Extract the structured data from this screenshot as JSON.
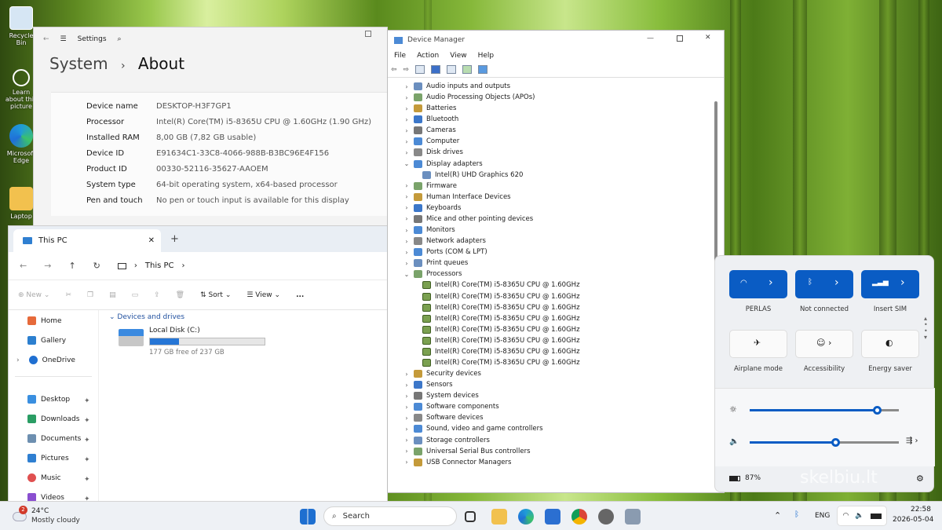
{
  "desktop": {
    "icons": [
      {
        "label": "Recycle Bin",
        "icon": "recycle-bin-icon"
      },
      {
        "label": "Learn about this picture",
        "icon": "learn-icon"
      },
      {
        "label": "Microsoft Edge",
        "icon": "edge-icon"
      },
      {
        "label": "Laptop",
        "icon": "folder-user-icon"
      }
    ]
  },
  "settings": {
    "app_title": "Settings",
    "crumb_parent": "System",
    "crumb_sep": "›",
    "crumb_current": "About",
    "specs": [
      {
        "label": "Device name",
        "value": "DESKTOP-H3F7GP1"
      },
      {
        "label": "Processor",
        "value": "Intel(R) Core(TM) i5-8365U CPU @ 1.60GHz (1.90 GHz)"
      },
      {
        "label": "Installed RAM",
        "value": "8,00 GB (7,82 GB usable)"
      },
      {
        "label": "Device ID",
        "value": "E91634C1-33C8-4066-988B-B3BC96E4F156"
      },
      {
        "label": "Product ID",
        "value": "00330-52116-35627-AAOEM"
      },
      {
        "label": "System type",
        "value": "64-bit operating system, x64-based processor"
      },
      {
        "label": "Pen and touch",
        "value": "No pen or touch input is available for this display"
      }
    ]
  },
  "explorer": {
    "tab_title": "This PC",
    "address": "This PC",
    "toolbar": {
      "new": "New",
      "sort": "Sort",
      "view": "View",
      "more": "..."
    },
    "nav": [
      "Home",
      "Gallery",
      "OneDrive",
      "Desktop",
      "Downloads",
      "Documents",
      "Pictures",
      "Music",
      "Videos"
    ],
    "section": "Devices and drives",
    "drive": {
      "name": "Local Disk (C:)",
      "free": "177 GB free of 237 GB",
      "used_fraction": 0.253
    }
  },
  "devmgr": {
    "title": "Device Manager",
    "menu": [
      "File",
      "Action",
      "View",
      "Help"
    ],
    "tree": [
      {
        "label": "Audio inputs and outputs",
        "level": 1,
        "expanded": false
      },
      {
        "label": "Audio Processing Objects (APOs)",
        "level": 1,
        "expanded": false
      },
      {
        "label": "Batteries",
        "level": 1,
        "expanded": false
      },
      {
        "label": "Bluetooth",
        "level": 1,
        "expanded": false
      },
      {
        "label": "Cameras",
        "level": 1,
        "expanded": false
      },
      {
        "label": "Computer",
        "level": 1,
        "expanded": false
      },
      {
        "label": "Disk drives",
        "level": 1,
        "expanded": false
      },
      {
        "label": "Display adapters",
        "level": 1,
        "expanded": true
      },
      {
        "label": "Intel(R) UHD Graphics 620",
        "level": 2
      },
      {
        "label": "Firmware",
        "level": 1,
        "expanded": false
      },
      {
        "label": "Human Interface Devices",
        "level": 1,
        "expanded": false
      },
      {
        "label": "Keyboards",
        "level": 1,
        "expanded": false
      },
      {
        "label": "Mice and other pointing devices",
        "level": 1,
        "expanded": false
      },
      {
        "label": "Monitors",
        "level": 1,
        "expanded": false
      },
      {
        "label": "Network adapters",
        "level": 1,
        "expanded": false
      },
      {
        "label": "Ports (COM & LPT)",
        "level": 1,
        "expanded": false
      },
      {
        "label": "Print queues",
        "level": 1,
        "expanded": false
      },
      {
        "label": "Processors",
        "level": 1,
        "expanded": true
      },
      {
        "label": "Intel(R) Core(TM) i5-8365U CPU @ 1.60GHz",
        "level": 2
      },
      {
        "label": "Intel(R) Core(TM) i5-8365U CPU @ 1.60GHz",
        "level": 2
      },
      {
        "label": "Intel(R) Core(TM) i5-8365U CPU @ 1.60GHz",
        "level": 2
      },
      {
        "label": "Intel(R) Core(TM) i5-8365U CPU @ 1.60GHz",
        "level": 2
      },
      {
        "label": "Intel(R) Core(TM) i5-8365U CPU @ 1.60GHz",
        "level": 2
      },
      {
        "label": "Intel(R) Core(TM) i5-8365U CPU @ 1.60GHz",
        "level": 2
      },
      {
        "label": "Intel(R) Core(TM) i5-8365U CPU @ 1.60GHz",
        "level": 2
      },
      {
        "label": "Intel(R) Core(TM) i5-8365U CPU @ 1.60GHz",
        "level": 2
      },
      {
        "label": "Security devices",
        "level": 1,
        "expanded": false
      },
      {
        "label": "Sensors",
        "level": 1,
        "expanded": false
      },
      {
        "label": "System devices",
        "level": 1,
        "expanded": false
      },
      {
        "label": "Software components",
        "level": 1,
        "expanded": false
      },
      {
        "label": "Software devices",
        "level": 1,
        "expanded": false
      },
      {
        "label": "Sound, video and game controllers",
        "level": 1,
        "expanded": false
      },
      {
        "label": "Storage controllers",
        "level": 1,
        "expanded": false
      },
      {
        "label": "Universal Serial Bus controllers",
        "level": 1,
        "expanded": false
      },
      {
        "label": "USB Connector Managers",
        "level": 1,
        "expanded": false
      }
    ]
  },
  "quick": {
    "tiles_row1": [
      "PERLAS",
      "Not connected",
      "Insert SIM"
    ],
    "tiles_row2": [
      "Airplane mode",
      "Accessibility",
      "Energy saver"
    ],
    "brightness": 0.86,
    "volume": 0.58,
    "battery": "87%",
    "accent": "#0a5cc4"
  },
  "taskbar": {
    "weather_temp": "24°C",
    "weather_text": "Mostly cloudy",
    "weather_badge": "2",
    "search": "Search",
    "lang": "ENG",
    "time": "22:58",
    "date": "2026-05-04"
  },
  "watermark": "skelbiu.lt"
}
